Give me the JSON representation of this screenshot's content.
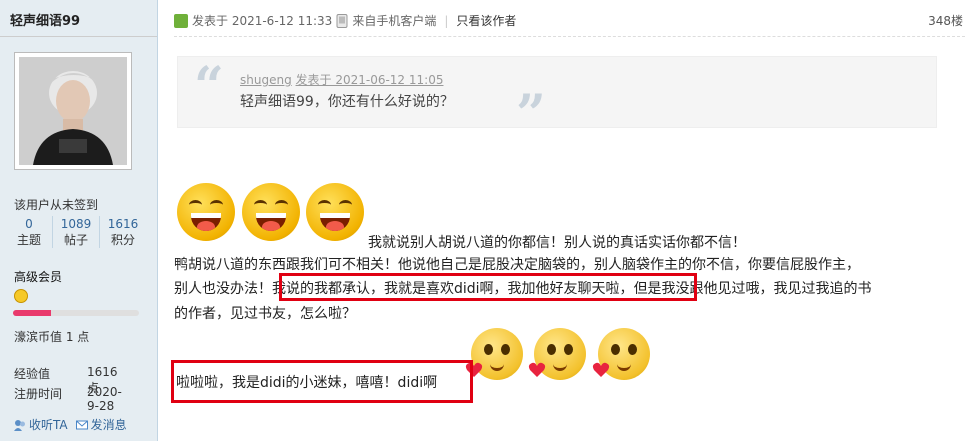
{
  "sidebar": {
    "username": "轻声细语99",
    "sign_status": "该用户从未签到",
    "stats": [
      {
        "num": "0",
        "label": "主题"
      },
      {
        "num": "1089",
        "label": "帖子"
      },
      {
        "num": "1616",
        "label": "积分"
      }
    ],
    "group": "高级会员",
    "level_progress": 0.3,
    "wealth": "濠滨币值   1 点",
    "exp_label": "经验值",
    "exp_value": "1616 点",
    "reg_label": "注册时间",
    "reg_value": "2020-9-28",
    "follow": "收听TA",
    "message": "发消息"
  },
  "post": {
    "posted_at": "发表于  2021-6-12 11:33",
    "client": "来自手机客户端",
    "only_author": "只看该作者",
    "floor": "348楼",
    "quote": {
      "author": "shugeng",
      "time": "发表于 2021-06-12 11:05",
      "text": "轻声细语99，你还有什么好说的？"
    },
    "line1": "我就说别人胡说八道的你都信！别人说的真话实话你都不信！",
    "line2": "鸭胡说八道的东西跟我们可不相关！他说他自己是屁股决定脑袋的，别人脑袋作主的你不信，你要信屁股作主，",
    "line3_a": "别人也没办法！",
    "line3_hl": "我说的我都承认，我就是喜欢didi啊，我加他好友聊天啦，",
    "line3_b": "但是我没跟他见过哦，我见过我追的书",
    "line4": "的作者，见过书友，怎么啦？",
    "line5": "啦啦啦，我是didi的小迷妹，嘻嘻！didi啊"
  }
}
